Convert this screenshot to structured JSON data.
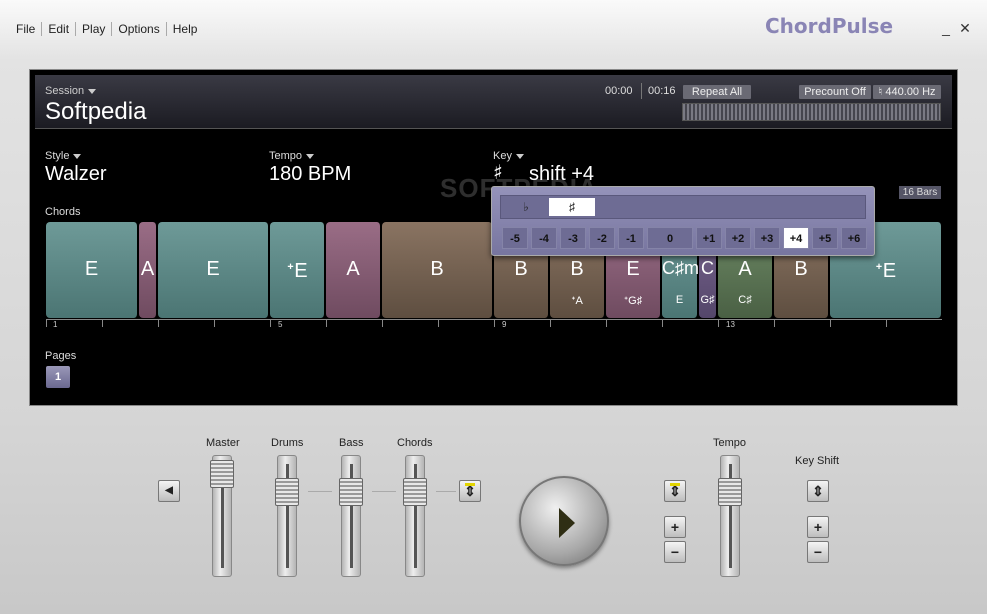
{
  "app": {
    "title": "ChordPulse"
  },
  "menu": [
    "File",
    "Edit",
    "Play",
    "Options",
    "Help"
  ],
  "window": {
    "minimize": "_",
    "close": "✕"
  },
  "session": {
    "label": "Session",
    "name": "Softpedia"
  },
  "transport": {
    "current_time": "00:00",
    "total_time": "00:16",
    "repeat": "Repeat All",
    "precount": "Precount Off",
    "tuning": "♮ 440.00 Hz"
  },
  "style": {
    "label": "Style",
    "value": "Walzer"
  },
  "tempo": {
    "label": "Tempo",
    "value": "180 BPM"
  },
  "key": {
    "label": "Key",
    "sharp": "♯",
    "value": "shift +4"
  },
  "watermark": "SOFTPEDIA",
  "bars_badge": "16 Bars",
  "chords_label": "Chords",
  "chords": [
    {
      "name": "E",
      "sub": ""
    },
    {
      "name": "A",
      "sub": ""
    },
    {
      "name": "E",
      "sub": ""
    },
    {
      "name": "ᐩE",
      "sub": ""
    },
    {
      "name": "A",
      "sub": ""
    },
    {
      "name": "B",
      "sub": ""
    },
    {
      "name": "B",
      "sub": ""
    },
    {
      "name": "B",
      "sub": "ᐩA"
    },
    {
      "name": "E",
      "sub": "ᐩG♯"
    },
    {
      "name": "C♯m",
      "sub": "E"
    },
    {
      "name": "C",
      "sub": "G♯"
    },
    {
      "name": "A",
      "sub": "C♯"
    },
    {
      "name": "B",
      "sub": ""
    },
    {
      "name": "ᐩE",
      "sub": ""
    }
  ],
  "ruler_numbers": [
    "1",
    "5",
    "9",
    "13"
  ],
  "pages": {
    "label": "Pages",
    "current": "1"
  },
  "key_popup": {
    "flat": "♭",
    "sharp": "♯",
    "shifts": [
      "-5",
      "-4",
      "-3",
      "-2",
      "-1",
      "0",
      "+1",
      "+2",
      "+3",
      "+4",
      "+5",
      "+6"
    ],
    "selected": "+4"
  },
  "mixer": {
    "master_label": "Master",
    "drums_label": "Drums",
    "bass_label": "Bass",
    "chords_label": "Chords",
    "tempo_label": "Tempo",
    "keyshift_label": "Key Shift",
    "mute_icon": "◀",
    "plus": "+",
    "minus": "−",
    "reset": "⇕"
  },
  "colors": {
    "title_accent": "#8a85b5",
    "selected_shift": "#ffffff",
    "led": "#e2d400"
  }
}
